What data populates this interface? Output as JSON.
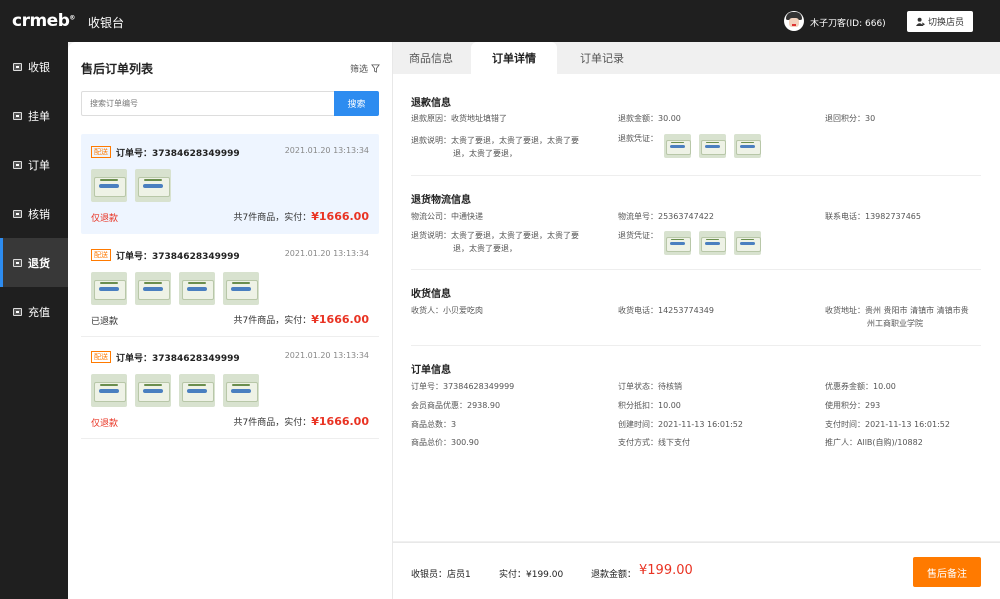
{
  "topbar": {
    "logo": "crmeb",
    "logo_mark": "®",
    "title": "收银台",
    "username": "木子刀客(ID: 666)",
    "switch_label": "切换店员"
  },
  "sidebar": {
    "items": [
      {
        "label": "收银",
        "active": false
      },
      {
        "label": "挂单",
        "active": false
      },
      {
        "label": "订单",
        "active": false
      },
      {
        "label": "核销",
        "active": false
      },
      {
        "label": "退货",
        "active": true
      },
      {
        "label": "充值",
        "active": false
      }
    ]
  },
  "order_list": {
    "title": "售后订单列表",
    "filter_label": "筛选",
    "search": {
      "placeholder": "搜索订单编号",
      "button": "搜索"
    },
    "orders": [
      {
        "tag": "配送",
        "order_no": "订单号：37384628349999",
        "time": "2021.01.20 13:13:34",
        "status": "仅退款",
        "status_color": "#e93323",
        "summary": "共7件商品，实付：",
        "amount": "¥1666.00",
        "images": 2
      },
      {
        "tag": "配送",
        "order_no": "订单号：37384628349999",
        "time": "2021.01.20 13:13:34",
        "status": "已退款",
        "status_color": "#333333",
        "summary": "共7件商品，实付：",
        "amount": "¥1666.00",
        "images": 4
      },
      {
        "tag": "配送",
        "order_no": "订单号：37384628349999",
        "time": "2021.01.20 13:13:34",
        "status": "仅退款",
        "status_color": "#e93323",
        "summary": "共7件商品，实付：",
        "amount": "¥1666.00",
        "images": 4
      }
    ]
  },
  "tabs": [
    "商品信息",
    "订单详情",
    "订单记录"
  ],
  "active_tab": "订单详情",
  "detail": {
    "refund": {
      "title": "退款信息",
      "reason": "退款原因：收货地址填错了",
      "amount": "退款金额：30.00",
      "points": "退回积分：30",
      "desc_line1": "退款说明：太贵了要退，太贵了要退，太贵了要",
      "desc_line2": "退，太贵了要退，",
      "proof": "退款凭证："
    },
    "logistics": {
      "title": "退货物流信息",
      "company": "物流公司：中通快递",
      "tracking": "物流单号：25363747422",
      "phone": "联系电话：13982737465",
      "desc_line1": "退货说明：太贵了要退，太贵了要退，太贵了要",
      "desc_line2": "退，太贵了要退，",
      "proof": "退货凭证："
    },
    "receive": {
      "title": "收货信息",
      "name": "收货人：小贝爱吃肉",
      "phone": "收货电话：14253774349",
      "addr_line1": "收货地址：贵州 贵阳市 清镇市 清镇市贵",
      "addr_line2": "州工商职业学院"
    },
    "order": {
      "title": "订单信息",
      "fields": [
        "订单号：37384628349999",
        "订单状态：待核销",
        "优惠券金额：10.00",
        "会员商品优惠：2938.90",
        "积分抵扣：10.00",
        "使用积分：293",
        "商品总数：3",
        "创建时间：2021-11-13 16:01:52",
        "支付时间：2021-11-13 16:01:52",
        "商品总价：300.90",
        "支付方式：线下支付",
        "推广人：AllB(自购)/10882"
      ]
    }
  },
  "bottom": {
    "cashier": "收银员：店员1",
    "paid": "实付：¥199.00",
    "refund_label": "退款金额：",
    "refund_amount": "¥199.00",
    "remark_button": "售后备注"
  },
  "colors": {
    "accent": "#2d8cf0",
    "price_red": "#e93323",
    "orange": "#ff7a00",
    "sidebar_bg": "#1f1f1f"
  },
  "icons": {
    "user": "user-switch-icon",
    "filter": "filter-icon"
  }
}
